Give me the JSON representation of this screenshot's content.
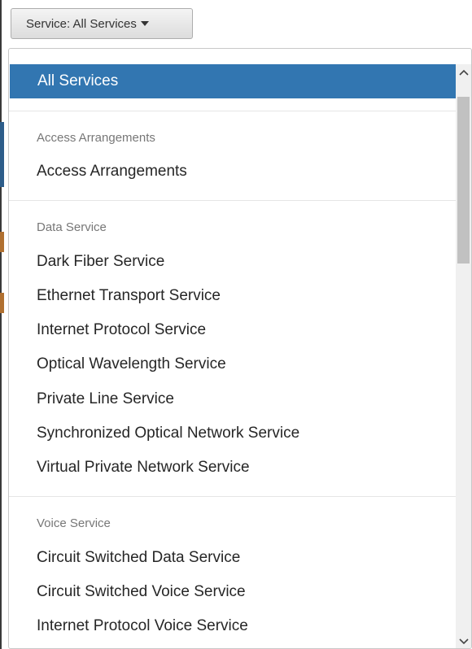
{
  "toggle": {
    "label": "Service: All Services"
  },
  "menu": {
    "active_item": "All Services",
    "groups": [
      {
        "header": "Access Arrangements",
        "items": [
          "Access Arrangements"
        ]
      },
      {
        "header": "Data Service",
        "items": [
          "Dark Fiber Service",
          "Ethernet Transport Service",
          "Internet Protocol Service",
          "Optical Wavelength Service",
          "Private Line Service",
          "Synchronized Optical Network Service",
          "Virtual Private Network Service"
        ]
      },
      {
        "header": "Voice Service",
        "items": [
          "Circuit Switched Data Service",
          "Circuit Switched Voice Service",
          "Internet Protocol Voice Service"
        ]
      }
    ]
  },
  "icons": {
    "caret": "caret-down-icon",
    "scroll_up": "chevron-up-icon",
    "scroll_down": "chevron-down-icon"
  },
  "colors": {
    "active_background": "#3276b1",
    "active_text": "#ffffff",
    "header_text": "#777777",
    "item_text": "#262626"
  }
}
